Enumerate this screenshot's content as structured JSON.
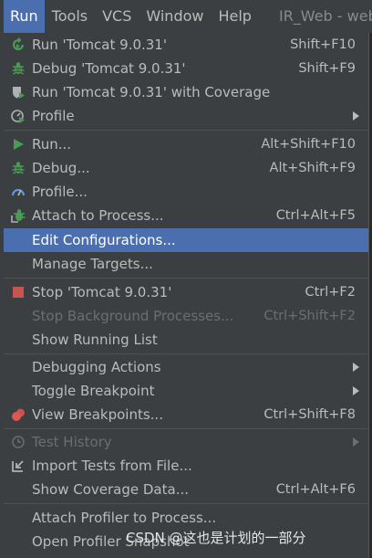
{
  "menubar": {
    "items": [
      "Run",
      "Tools",
      "VCS",
      "Window",
      "Help"
    ],
    "project": "IR_Web - web.x"
  },
  "colors": {
    "selection": "#4b6eaf",
    "menu_bg": "#3c3f41",
    "text": "#bbbbbb",
    "disabled_text": "#6d6d6d",
    "run_green": "#499c54",
    "stop_red": "#c75450"
  },
  "menu": {
    "run_config": {
      "label": "Run 'Tomcat 9.0.31'",
      "shortcut": "Shift+F10",
      "icon": "rerun-icon"
    },
    "debug_config": {
      "label": "Debug 'Tomcat 9.0.31'",
      "shortcut": "Shift+F9",
      "icon": "bug-icon"
    },
    "coverage_config": {
      "label": "Run 'Tomcat 9.0.31' with Coverage",
      "icon": "coverage-shield-icon"
    },
    "profile_config": {
      "label": "Profile",
      "icon": "profile-icon"
    },
    "run": {
      "label": "Run...",
      "shortcut": "Alt+Shift+F10",
      "icon": "play-icon"
    },
    "debug": {
      "label": "Debug...",
      "shortcut": "Alt+Shift+F9",
      "icon": "bug-icon"
    },
    "profile": {
      "label": "Profile...",
      "icon": "gauge-icon"
    },
    "attach": {
      "label": "Attach to Process...",
      "shortcut": "Ctrl+Alt+F5",
      "icon": "attach-bug-icon"
    },
    "edit_config": {
      "label": "Edit Configurations..."
    },
    "manage_targets": {
      "label": "Manage Targets..."
    },
    "stop": {
      "label": "Stop 'Tomcat 9.0.31'",
      "shortcut": "Ctrl+F2",
      "icon": "stop-icon"
    },
    "stop_background": {
      "label": "Stop Background Processes...",
      "shortcut": "Ctrl+Shift+F2"
    },
    "show_running": {
      "label": "Show Running List"
    },
    "debugging_actions": {
      "label": "Debugging Actions"
    },
    "toggle_breakpoint": {
      "label": "Toggle Breakpoint"
    },
    "view_breakpoints": {
      "label": "View Breakpoints...",
      "shortcut": "Ctrl+Shift+F8",
      "icon": "breakpoints-icon"
    },
    "test_history": {
      "label": "Test History",
      "icon": "clock-icon"
    },
    "import_tests": {
      "label": "Import Tests from File...",
      "icon": "import-icon"
    },
    "show_coverage": {
      "label": "Show Coverage Data...",
      "shortcut": "Ctrl+Alt+F6"
    },
    "attach_profiler": {
      "label": "Attach Profiler to Process..."
    },
    "open_snapshot": {
      "label": "Open Profiler Snapshot"
    }
  },
  "watermark": "CSDN @这也是计划的一部分"
}
